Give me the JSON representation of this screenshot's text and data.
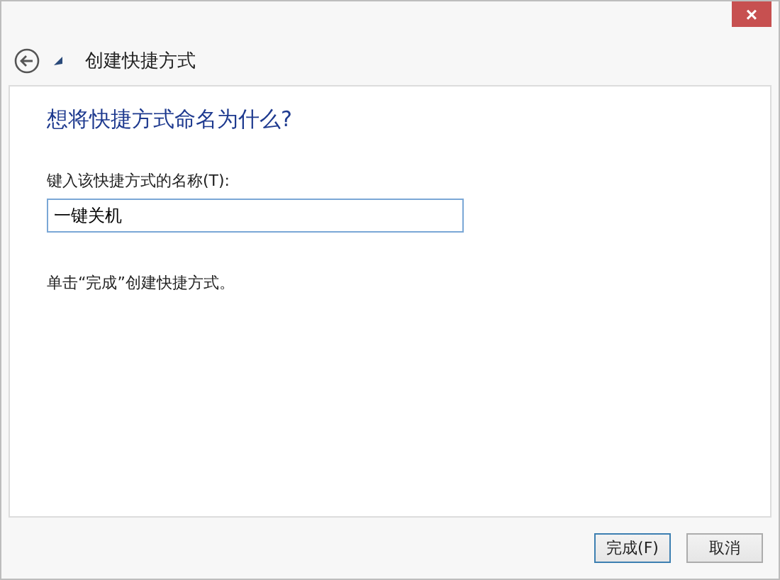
{
  "window": {
    "close": "×",
    "title": "创建快捷方式"
  },
  "heading": "想将快捷方式命名为什么?",
  "name_field": {
    "label": "键入该快捷方式的名称(T):",
    "value": "一键关机"
  },
  "hint": "单击“完成”创建快捷方式。",
  "buttons": [
    {
      "label": "完成(F)",
      "default": true
    },
    {
      "label": "取消",
      "default": false
    }
  ]
}
